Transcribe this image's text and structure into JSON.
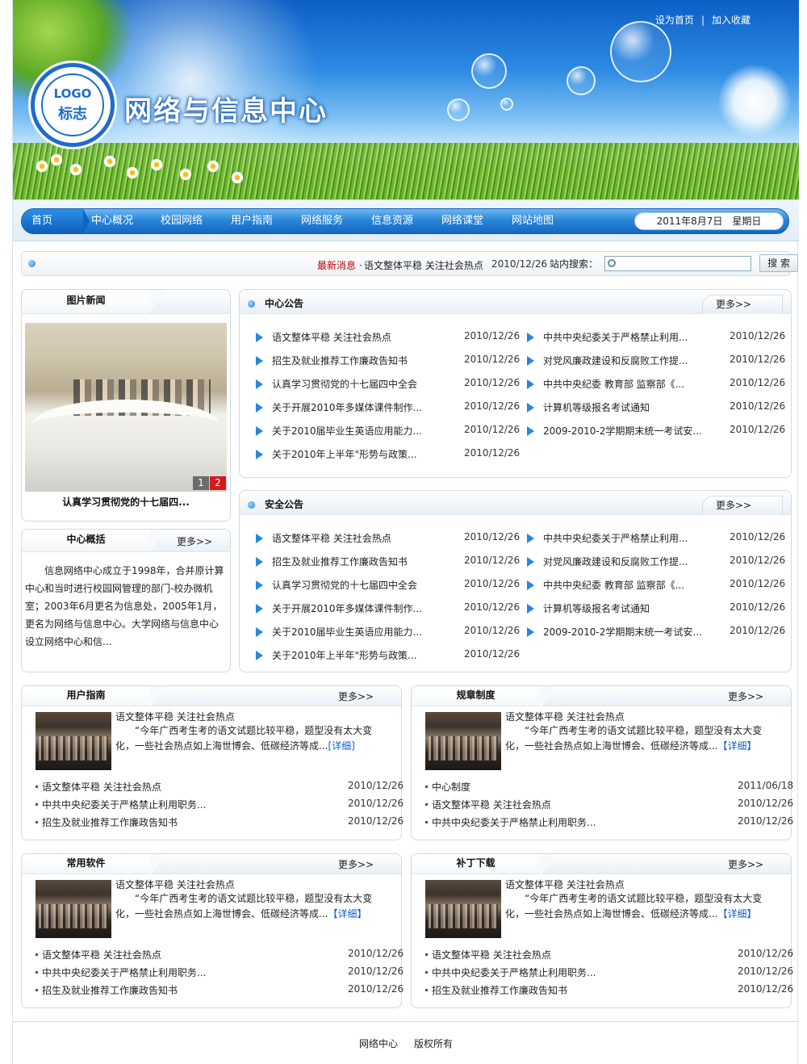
{
  "header": {
    "site_title": "网络与信息中心",
    "logo_text_top": "LOGO",
    "logo_text_bottom": "标志",
    "set_home": "设为首页",
    "separator": "|",
    "add_favorite": "加入收藏"
  },
  "nav": {
    "items": [
      "首页",
      "中心概况",
      "校园网络",
      "用户指南",
      "网络服务",
      "信息资源",
      "网络课堂",
      "网站地图"
    ],
    "date": "2011年8月7日　星期日"
  },
  "ticker": {
    "label": "最新消息",
    "dot": "·",
    "headline": "语文整体平稳 关注社会热点",
    "date": "2010/12/26",
    "search_label": "站内搜索：",
    "search_value": "",
    "search_button": "搜 索"
  },
  "photo_news": {
    "title": "图片新闻",
    "caption": "认真学习贯彻党的十七届四...",
    "page1": "1",
    "page2": "2"
  },
  "overview": {
    "title": "中心概括",
    "more": "更多>>",
    "text": "信息网络中心成立于1998年，合并原计算中心和当时进行校园网管理的部门-校办微机室；2003年6月更名为信息处，2005年1月，更名为网络与信息中心。大学网络与信息中心设立网络中心和信..."
  },
  "center_notice": {
    "title": "中心公告",
    "more": "更多>>",
    "left": [
      {
        "text": "语文整体平稳 关注社会热点",
        "date": "2010/12/26"
      },
      {
        "text": "招生及就业推荐工作廉政告知书",
        "date": "2010/12/26"
      },
      {
        "text": "认真学习贯彻党的十七届四中全会",
        "date": "2010/12/26"
      },
      {
        "text": "关于开展2010年多媒体课件制作...",
        "date": "2010/12/26"
      },
      {
        "text": "关于2010届毕业生英语应用能力...",
        "date": "2010/12/26"
      },
      {
        "text": "关于2010年上半年\"形势与政策...",
        "date": "2010/12/26"
      }
    ],
    "right": [
      {
        "text": "中共中央纪委关于严格禁止利用...",
        "date": "2010/12/26"
      },
      {
        "text": "对党风廉政建设和反腐败工作提...",
        "date": "2010/12/26"
      },
      {
        "text": "中共中央纪委 教育部 监察部《...",
        "date": "2010/12/26"
      },
      {
        "text": "计算机等级报名考试通知",
        "date": "2010/12/26"
      },
      {
        "text": "2009-2010-2学期期末统一考试安...",
        "date": "2010/12/26"
      }
    ]
  },
  "security_notice": {
    "title": "安全公告",
    "more": "更多>>",
    "left": [
      {
        "text": "语文整体平稳 关注社会热点",
        "date": "2010/12/26"
      },
      {
        "text": "招生及就业推荐工作廉政告知书",
        "date": "2010/12/26"
      },
      {
        "text": "认真学习贯彻党的十七届四中全会",
        "date": "2010/12/26"
      },
      {
        "text": "关于开展2010年多媒体课件制作...",
        "date": "2010/12/26"
      },
      {
        "text": "关于2010届毕业生英语应用能力...",
        "date": "2010/12/26"
      },
      {
        "text": "关于2010年上半年\"形势与政策...",
        "date": "2010/12/26"
      }
    ],
    "right": [
      {
        "text": "中共中央纪委关于严格禁止利用...",
        "date": "2010/12/26"
      },
      {
        "text": "对党风廉政建设和反腐败工作提...",
        "date": "2010/12/26"
      },
      {
        "text": "中共中央纪委 教育部 监察部《...",
        "date": "2010/12/26"
      },
      {
        "text": "计算机等级报名考试通知",
        "date": "2010/12/26"
      },
      {
        "text": "2009-2010-2学期期末统一考试安...",
        "date": "2010/12/26"
      }
    ]
  },
  "boxes": [
    {
      "title": "用户指南",
      "more": "更多>>",
      "headline": "语文整体平稳 关注社会热点",
      "summary": "“今年广西考生考的语文试题比较平稳，题型没有太大变化，一些社会热点如上海世博会、低碳经济等成...",
      "detail": "[详细]",
      "items": [
        {
          "text": "语文整体平稳 关注社会热点",
          "date": "2010/12/26"
        },
        {
          "text": "中共中央纪委关于严格禁止利用职务...",
          "date": "2010/12/26"
        },
        {
          "text": "招生及就业推荐工作廉政告知书",
          "date": "2010/12/26"
        }
      ]
    },
    {
      "title": "规章制度",
      "more": "更多>>",
      "headline": "语文整体平稳 关注社会热点",
      "summary": "“今年广西考生考的语文试题比较平稳，题型没有太大变化，一些社会热点如上海世博会、低碳经济等成...",
      "detail": "【详细】",
      "items": [
        {
          "text": "中心制度",
          "date": "2011/06/18"
        },
        {
          "text": "语文整体平稳 关注社会热点",
          "date": "2010/12/26"
        },
        {
          "text": "中共中央纪委关于严格禁止利用职务...",
          "date": "2010/12/26"
        }
      ]
    },
    {
      "title": "常用软件",
      "more": "更多>>",
      "headline": "语文整体平稳 关注社会热点",
      "summary": "“今年广西考生考的语文试题比较平稳，题型没有太大变化，一些社会热点如上海世博会、低碳经济等成...",
      "detail": "【详细】",
      "items": [
        {
          "text": "语文整体平稳 关注社会热点",
          "date": "2010/12/26"
        },
        {
          "text": "中共中央纪委关于严格禁止利用职务...",
          "date": "2010/12/26"
        },
        {
          "text": "招生及就业推荐工作廉政告知书",
          "date": "2010/12/26"
        }
      ]
    },
    {
      "title": "补丁下载",
      "more": "更多>>",
      "headline": "语文整体平稳 关注社会热点",
      "summary": "“今年广西考生考的语文试题比较平稳，题型没有太大变化，一些社会热点如上海世博会、低碳经济等成...",
      "detail": "【详细】",
      "items": [
        {
          "text": "语文整体平稳 关注社会热点",
          "date": "2010/12/26"
        },
        {
          "text": "中共中央纪委关于严格禁止利用职务...",
          "date": "2010/12/26"
        },
        {
          "text": "招生及就业推荐工作廉政告知书",
          "date": "2010/12/26"
        }
      ]
    }
  ],
  "footer": {
    "left": "网络中心",
    "right": "版权所有"
  },
  "colors": {
    "nav_blue": "#1468c3",
    "accent_red": "#c00000",
    "link_blue": "#0b5fc7"
  }
}
